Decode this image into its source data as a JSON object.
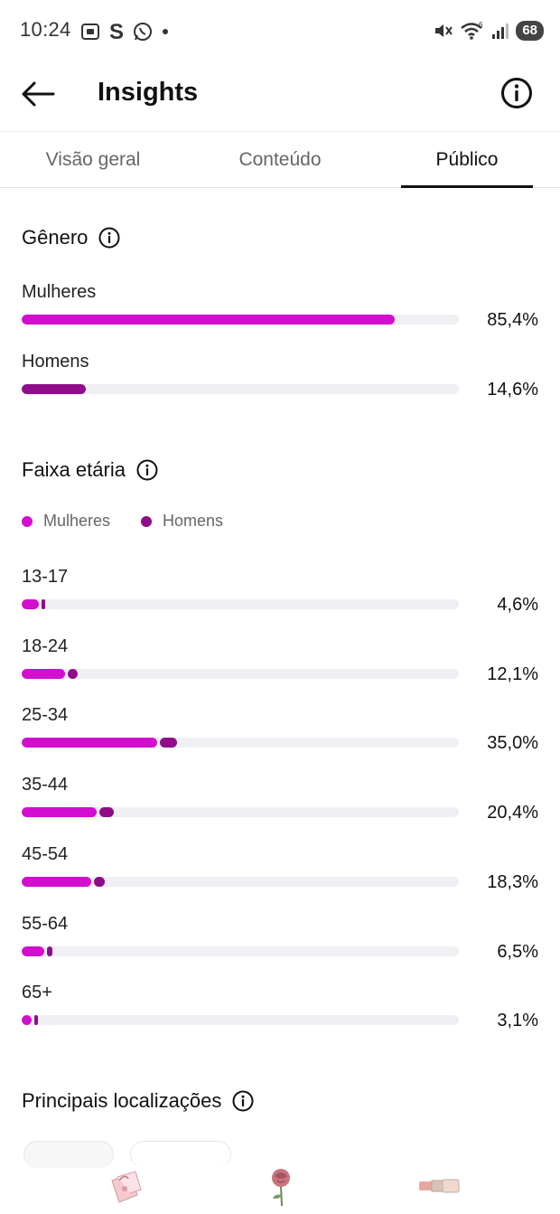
{
  "status_bar": {
    "time": "10:24",
    "battery": "68",
    "left_icons": [
      "screenshot-icon",
      "s-app-icon",
      "whatsapp-icon",
      "dot-icon"
    ],
    "right_icons": [
      "mute-icon",
      "wifi-icon",
      "signal-icon"
    ]
  },
  "header": {
    "title": "Insights"
  },
  "tabs": [
    {
      "label": "Visão geral",
      "active": false
    },
    {
      "label": "Conteúdo",
      "active": false
    },
    {
      "label": "Público",
      "active": true
    }
  ],
  "colors": {
    "women": "#d30ecf",
    "men": "#8f0d8a",
    "track": "#efeff4"
  },
  "gender": {
    "title": "Gênero",
    "rows": [
      {
        "label": "Mulheres",
        "value": "85,4%",
        "fraction": 0.854
      },
      {
        "label": "Homens",
        "value": "14,6%",
        "fraction": 0.146
      }
    ]
  },
  "age": {
    "title": "Faixa etária",
    "legend": [
      "Mulheres",
      "Homens"
    ],
    "rows": [
      {
        "label": "13-17",
        "value": "4,6%",
        "women_fraction": 0.039,
        "men_fraction": 0.007
      },
      {
        "label": "18-24",
        "value": "12,1%",
        "women_fraction": 0.1,
        "men_fraction": 0.021
      },
      {
        "label": "25-34",
        "value": "35,0%",
        "women_fraction": 0.309,
        "men_fraction": 0.041
      },
      {
        "label": "35-44",
        "value": "20,4%",
        "women_fraction": 0.172,
        "men_fraction": 0.032
      },
      {
        "label": "45-54",
        "value": "18,3%",
        "women_fraction": 0.16,
        "men_fraction": 0.023
      },
      {
        "label": "55-64",
        "value": "6,5%",
        "women_fraction": 0.052,
        "men_fraction": 0.013
      },
      {
        "label": "65+",
        "value": "3,1%",
        "women_fraction": 0.022,
        "men_fraction": 0.009
      }
    ]
  },
  "locations": {
    "title": "Principais localizações"
  },
  "bottom_nav": [
    "gift-bag-icon",
    "rose-icon",
    "lipstick-icon"
  ]
}
